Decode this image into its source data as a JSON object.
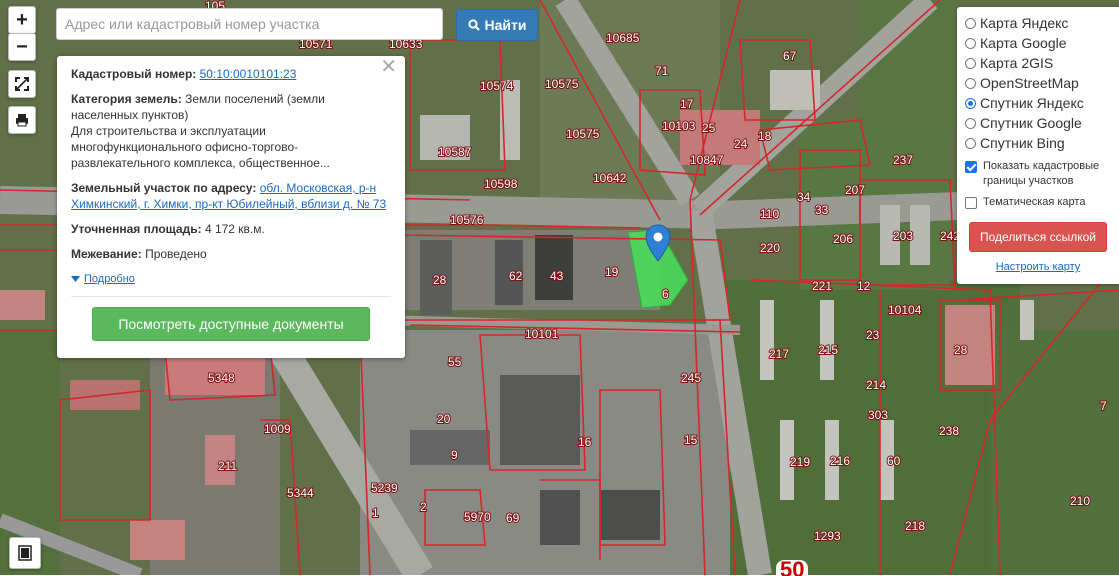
{
  "search": {
    "placeholder": "Адрес или кадастровый номер участка",
    "button_label": "Найти"
  },
  "controls": {
    "zoom_in": "+",
    "zoom_out": "−"
  },
  "popup": {
    "cadastral_label": "Кадастровый номер:",
    "cadastral_value": "50:10:0010101:23",
    "category_label": "Категория земель:",
    "category_value": "Земли поселений (земли населенных пунктов)",
    "purpose_text": "Для строительства и эксплуатации многофункционального офисно-торгово-развлекательного комплекса, общественное...",
    "address_label": "Земельный участок по адресу:",
    "address_value": "обл. Московская, р-н Химкинский, г. Химки, пр-кт Юбилейный, вблизи д. № 73",
    "area_label": "Уточненная площадь:",
    "area_value": "4 172 кв.м.",
    "survey_label": "Межевание:",
    "survey_value": "Проведено",
    "more_label": "Подробно",
    "docs_button": "Посмотреть доступные документы"
  },
  "layers": {
    "options": [
      {
        "label": "Карта Яндекс",
        "selected": false
      },
      {
        "label": "Карта Google",
        "selected": false
      },
      {
        "label": "Карта 2GIS",
        "selected": false
      },
      {
        "label": "OpenStreetMap",
        "selected": false
      },
      {
        "label": "Спутник Яндекс",
        "selected": true
      },
      {
        "label": "Спутник Google",
        "selected": false
      },
      {
        "label": "Спутник Bing",
        "selected": false
      }
    ],
    "show_borders_label": "Показать кадастровые границы участков",
    "show_borders_checked": true,
    "thematic_label": "Тематическая карта",
    "thematic_checked": false,
    "share_button": "Поделиться ссылкой",
    "configure_link": "Настроить карту"
  },
  "map": {
    "parcel_labels": [
      "10633",
      "10571",
      "10685",
      "10574",
      "10575",
      "71",
      "67",
      "17",
      "25",
      "10103",
      "10575",
      "10587",
      "10847",
      "24",
      "18",
      "237",
      "10642",
      "10598",
      "207",
      "33",
      "34",
      "110",
      "10576",
      "203",
      "242",
      "206",
      "220",
      "19",
      "43",
      "62",
      "28",
      "6",
      "221",
      "10101",
      "12",
      "10104",
      "23",
      "28",
      "55",
      "217",
      "215",
      "214",
      "5348",
      "20",
      "16",
      "15",
      "245",
      "303",
      "238",
      "1009",
      "9",
      "219",
      "216",
      "60",
      "211",
      "5344",
      "5239",
      "1",
      "2",
      "5970",
      "69",
      "1293",
      "218",
      "210",
      "7",
      "105"
    ],
    "scale_text": "50"
  }
}
